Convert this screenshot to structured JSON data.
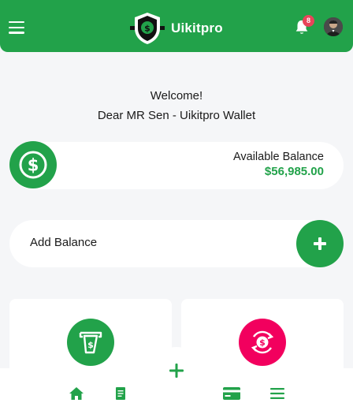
{
  "header": {
    "app_name": "Uikitpro",
    "notification_count": "8"
  },
  "greeting": {
    "welcome": "Welcome!",
    "subtitle": "Dear MR Sen - Uikitpro Wallet"
  },
  "balance": {
    "label": "Available Balance",
    "value": "$56,985.00"
  },
  "add_balance": {
    "label": "Add Balance"
  },
  "colors": {
    "primary": "#22a24a",
    "accent_pink": "#f2005e",
    "badge": "#e8445a"
  },
  "icons": {
    "menu": "hamburger-icon",
    "bell": "bell-icon",
    "wallet_balance": "dollar-icon",
    "add": "plus-icon",
    "tile_left": "money-withdraw-icon",
    "tile_right": "currency-exchange-icon",
    "nav_home": "home-icon",
    "nav_statement": "document-icon",
    "nav_cards": "credit-card-icon",
    "nav_more": "menu-lines-icon"
  }
}
